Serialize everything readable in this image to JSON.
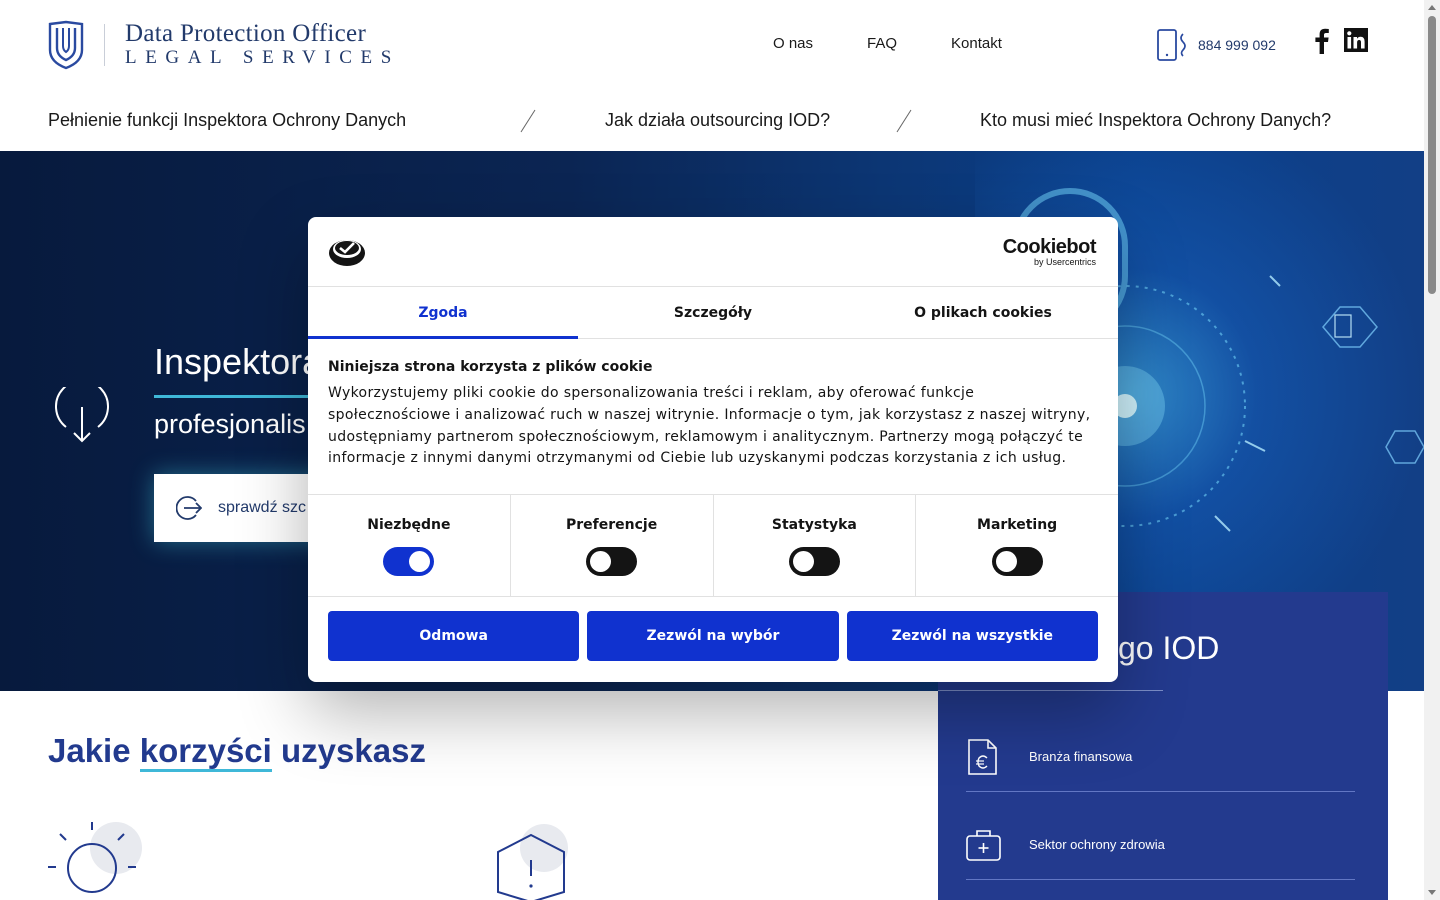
{
  "brand": {
    "title": "Data Protection Officer",
    "subtitle": "LEGAL SERVICES"
  },
  "topnav": [
    "O nas",
    "FAQ",
    "Kontakt"
  ],
  "phone": "884 999 092",
  "subnav": [
    "Pełnienie funkcji Inspektora Ochrony Danych",
    "Jak działa outsourcing IOD?",
    "Kto musi mieć Inspektora Ochrony Danych?"
  ],
  "hero": {
    "title": "Inspektora",
    "subtitle": "profesjonalis",
    "button": "sprawdź szc"
  },
  "side_panel": {
    "title": "go IOD",
    "items": [
      "Branża finansowa",
      "Sektor ochrony zdrowia"
    ]
  },
  "benefits": {
    "title_pre": "Jakie ",
    "title_hl": "korzyści",
    "title_post": " uzyskasz"
  },
  "cookie": {
    "brand_name": "Cookiebot",
    "brand_by": "by Usercentrics",
    "tabs": [
      "Zgoda",
      "Szczegóły",
      "O plikach cookies"
    ],
    "active_tab": "Zgoda",
    "heading": "Niniejsza strona korzysta z plików cookie",
    "text": "Wykorzystujemy pliki cookie do spersonalizowania treści i reklam, aby oferować funkcje społecznościowe i analizować ruch w naszej witrynie. Informacje o tym, jak korzystasz z naszej witryny, udostępniamy partnerom społecznościowym, reklamowym i analitycznym. Partnerzy mogą połączyć te informacje z innymi danymi otrzymanymi od Ciebie lub uzyskanymi podczas korzystania z ich usług.",
    "toggles": [
      {
        "label": "Niezbędne",
        "on": true
      },
      {
        "label": "Preferencje",
        "on": false
      },
      {
        "label": "Statystyka",
        "on": false
      },
      {
        "label": "Marketing",
        "on": false
      }
    ],
    "buttons": [
      "Odmowa",
      "Zezwól na wybór",
      "Zezwól na wszystkie"
    ]
  },
  "colors": {
    "accent": "#1032cf",
    "navy": "#223a6b",
    "panel": "#233a8e",
    "teal": "#3fb8d8"
  }
}
